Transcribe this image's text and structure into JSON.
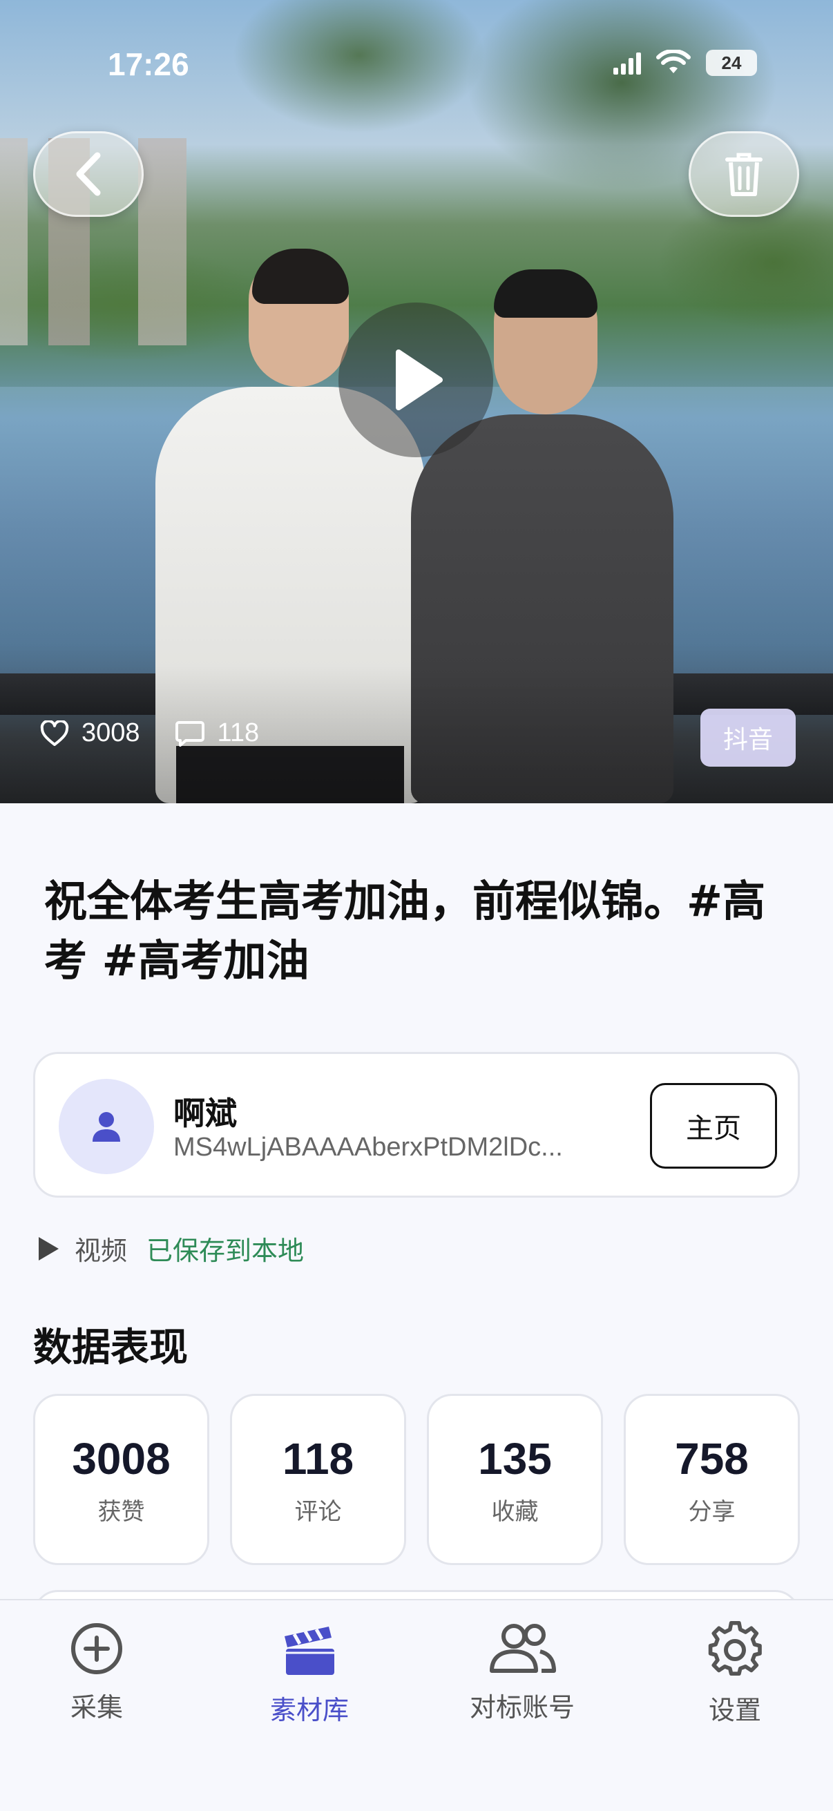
{
  "status_bar": {
    "time": "17:26",
    "battery": "24"
  },
  "video": {
    "likes": "3008",
    "comments": "118",
    "platform": "抖音"
  },
  "title": "祝全体考生高考加油，前程似锦。#高考 #高考加油",
  "author": {
    "name": "啊斌",
    "id": "MS4wLjABAAAAberxPtDM2lDc...",
    "home_button": "主页"
  },
  "media": {
    "type": "视频",
    "status": "已保存到本地"
  },
  "stats": {
    "section_title": "数据表现",
    "items": [
      {
        "value": "3008",
        "label": "获赞"
      },
      {
        "value": "118",
        "label": "评论"
      },
      {
        "value": "135",
        "label": "收藏"
      },
      {
        "value": "758",
        "label": "分享"
      }
    ]
  },
  "tabbar": {
    "active": "素材库",
    "items": [
      {
        "label": "采集",
        "icon": "plus-circle-icon"
      },
      {
        "label": "素材库",
        "icon": "clapperboard-icon"
      },
      {
        "label": "对标账号",
        "icon": "users-icon"
      },
      {
        "label": "设置",
        "icon": "gear-icon"
      }
    ]
  },
  "colors": {
    "accent": "#4a4fc9",
    "success": "#2e8b57",
    "platform_tag": "#e1deff"
  }
}
